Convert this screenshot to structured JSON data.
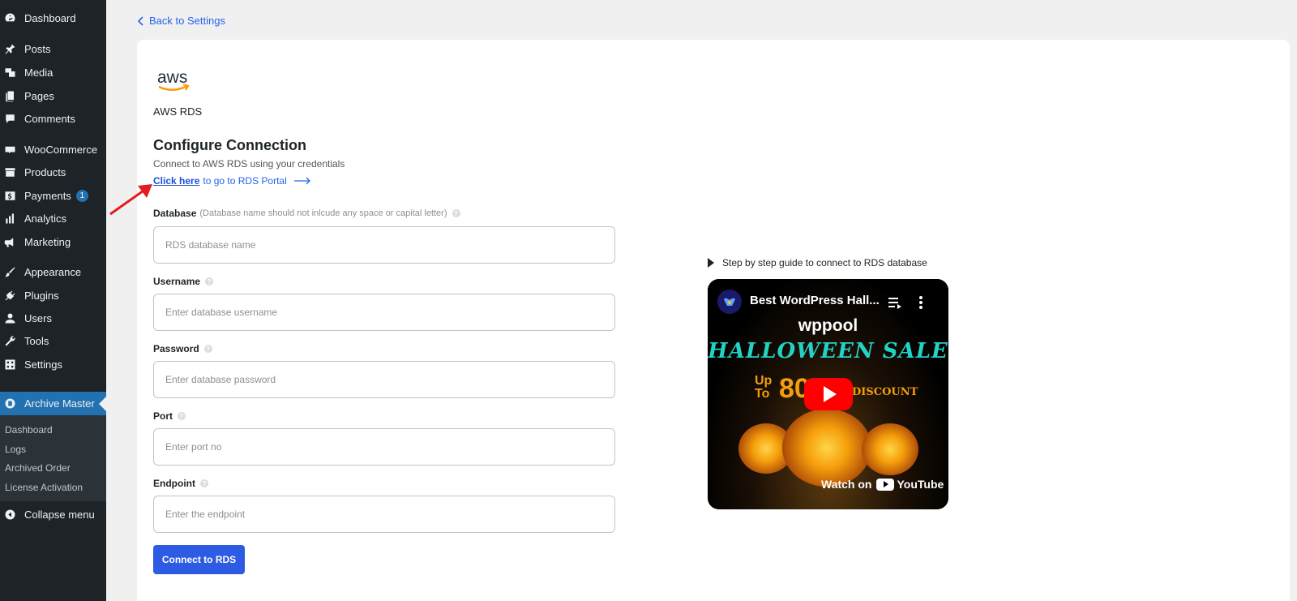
{
  "sidebar": {
    "items": [
      {
        "label": "Dashboard",
        "icon": "dashboard-icon"
      },
      {
        "label": "Posts",
        "icon": "pin-icon"
      },
      {
        "label": "Media",
        "icon": "media-icon"
      },
      {
        "label": "Pages",
        "icon": "pages-icon"
      },
      {
        "label": "Comments",
        "icon": "comment-icon"
      },
      {
        "label": "WooCommerce",
        "icon": "woocommerce-icon"
      },
      {
        "label": "Products",
        "icon": "archive-icon"
      },
      {
        "label": "Payments",
        "icon": "dollar-icon",
        "badge": "1"
      },
      {
        "label": "Analytics",
        "icon": "bar-chart-icon"
      },
      {
        "label": "Marketing",
        "icon": "megaphone-icon"
      },
      {
        "label": "Appearance",
        "icon": "brush-icon"
      },
      {
        "label": "Plugins",
        "icon": "plug-icon"
      },
      {
        "label": "Users",
        "icon": "user-icon"
      },
      {
        "label": "Tools",
        "icon": "wrench-icon"
      },
      {
        "label": "Settings",
        "icon": "settings-icon"
      },
      {
        "label": "Archive Master",
        "icon": "archive-master-icon",
        "active": true
      }
    ],
    "submenu": [
      "Dashboard",
      "Logs",
      "Archived Order",
      "License Activation"
    ],
    "collapse_label": "Collapse menu"
  },
  "back_label": "Back to Settings",
  "provider": {
    "logo_text": "aws",
    "name": "AWS RDS"
  },
  "heading": "Configure Connection",
  "description": "Connect to AWS RDS using your credentials",
  "portal": {
    "link_text": "Click here",
    "rest_text": "to go to RDS Portal"
  },
  "form": {
    "database": {
      "label": "Database",
      "hint": "(Database name should not inlcude any space or capital letter)",
      "placeholder": "RDS database name",
      "value": ""
    },
    "username": {
      "label": "Username",
      "placeholder": "Enter database username",
      "value": ""
    },
    "password": {
      "label": "Password",
      "placeholder": "Enter database password",
      "value": ""
    },
    "port": {
      "label": "Port",
      "placeholder": "Enter port no",
      "value": ""
    },
    "endpoint": {
      "label": "Endpoint",
      "placeholder": "Enter the endpoint",
      "value": ""
    }
  },
  "connect_label": "Connect to RDS",
  "guide": {
    "label": "Step by step guide to connect to RDS database",
    "video_title": "Best WordPress Hall...",
    "brand": "wppool",
    "headline": "HALLOWEEN SALE",
    "up_label": "Up",
    "to_label": "To",
    "percent": "80",
    "discount_label": "DISCOUNT",
    "watch_label": "Watch on",
    "yt_label": "YouTube"
  },
  "colors": {
    "sidebar_bg": "#1d2327",
    "active": "#2271b1",
    "primary_button": "#2d5be3",
    "link": "#2563eb",
    "aws_orange": "#ff9900"
  }
}
